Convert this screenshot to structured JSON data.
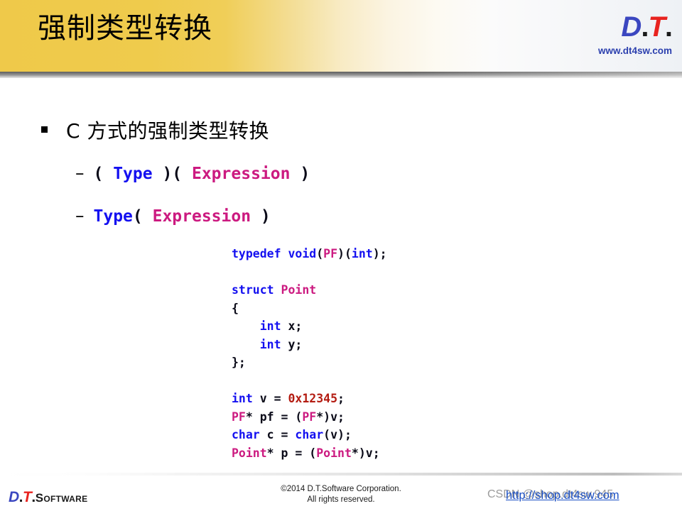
{
  "header": {
    "title": "强制类型转换",
    "logo": {
      "part_d": "D",
      "dot1": ".",
      "part_t": "T",
      "dot2": ".",
      "url": "www.dt4sw.com"
    }
  },
  "content": {
    "bullet_level1": "C 方式的强制类型转换",
    "bullet_marker": "square-bullet",
    "sub_bullets": [
      {
        "dash": "–",
        "tokens": [
          {
            "text": "( ",
            "color": "#0a0a18"
          },
          {
            "text": "Type",
            "color": "#1410f0"
          },
          {
            "text": " )( ",
            "color": "#0a0a18"
          },
          {
            "text": "Expression",
            "color": "#cc1a80"
          },
          {
            "text": " )",
            "color": "#0a0a18"
          }
        ]
      },
      {
        "dash": "–",
        "tokens": [
          {
            "text": "Type",
            "color": "#1410f0"
          },
          {
            "text": "( ",
            "color": "#0a0a18"
          },
          {
            "text": "Expression",
            "color": "#cc1a80"
          },
          {
            "text": " )",
            "color": "#0a0a18"
          }
        ]
      }
    ],
    "code_lines": [
      {
        "tokens": [
          {
            "text": "typedef void",
            "color": "#1410f0"
          },
          {
            "text": "(",
            "color": "#0a0a18"
          },
          {
            "text": "PF",
            "color": "#cc1a80"
          },
          {
            "text": ")(",
            "color": "#0a0a18"
          },
          {
            "text": "int",
            "color": "#1410f0"
          },
          {
            "text": ");",
            "color": "#0a0a18"
          }
        ]
      },
      {
        "tokens": []
      },
      {
        "tokens": [
          {
            "text": "struct ",
            "color": "#1410f0"
          },
          {
            "text": "Point",
            "color": "#cc1a80"
          }
        ]
      },
      {
        "tokens": [
          {
            "text": "{",
            "color": "#0a0a18"
          }
        ]
      },
      {
        "tokens": [
          {
            "text": "    ",
            "color": "#0a0a18"
          },
          {
            "text": "int",
            "color": "#1410f0"
          },
          {
            "text": " x;",
            "color": "#0a0a18"
          }
        ]
      },
      {
        "tokens": [
          {
            "text": "    ",
            "color": "#0a0a18"
          },
          {
            "text": "int",
            "color": "#1410f0"
          },
          {
            "text": " y;",
            "color": "#0a0a18"
          }
        ]
      },
      {
        "tokens": [
          {
            "text": "};",
            "color": "#0a0a18"
          }
        ]
      },
      {
        "tokens": []
      },
      {
        "tokens": [
          {
            "text": "int",
            "color": "#1410f0"
          },
          {
            "text": " v = ",
            "color": "#0a0a18"
          },
          {
            "text": "0x12345",
            "color": "#b41c12"
          },
          {
            "text": ";",
            "color": "#0a0a18"
          }
        ]
      },
      {
        "tokens": [
          {
            "text": "PF",
            "color": "#cc1a80"
          },
          {
            "text": "* pf = (",
            "color": "#0a0a18"
          },
          {
            "text": "PF",
            "color": "#cc1a80"
          },
          {
            "text": "*)v;",
            "color": "#0a0a18"
          }
        ]
      },
      {
        "tokens": [
          {
            "text": "char",
            "color": "#1410f0"
          },
          {
            "text": " c = ",
            "color": "#0a0a18"
          },
          {
            "text": "char",
            "color": "#1410f0"
          },
          {
            "text": "(v);",
            "color": "#0a0a18"
          }
        ]
      },
      {
        "tokens": [
          {
            "text": "Point",
            "color": "#cc1a80"
          },
          {
            "text": "* p = (",
            "color": "#0a0a18"
          },
          {
            "text": "Point",
            "color": "#cc1a80"
          },
          {
            "text": "*)v;",
            "color": "#0a0a18"
          }
        ]
      }
    ]
  },
  "footer": {
    "logo": {
      "part_d": "D",
      "dot1": ".",
      "part_t": "T",
      "dot2": ".",
      "word": "Software"
    },
    "copyright_line1": "©2014 D.T.Software Corporation.",
    "copyright_line2": "All rights reserved.",
    "watermark": "CSDN @shop.dt4sw.945",
    "link": "http://shop.dt4sw.com"
  },
  "colors": {
    "header_gold": "#efc94a",
    "keyword_blue": "#1410f0",
    "type_pink": "#cc1a80",
    "number_red": "#b41c12",
    "text_black": "#0a0a18",
    "brand_blue": "#3b47c0",
    "brand_red": "#e8231f",
    "link_blue": "#1a4fc4"
  }
}
